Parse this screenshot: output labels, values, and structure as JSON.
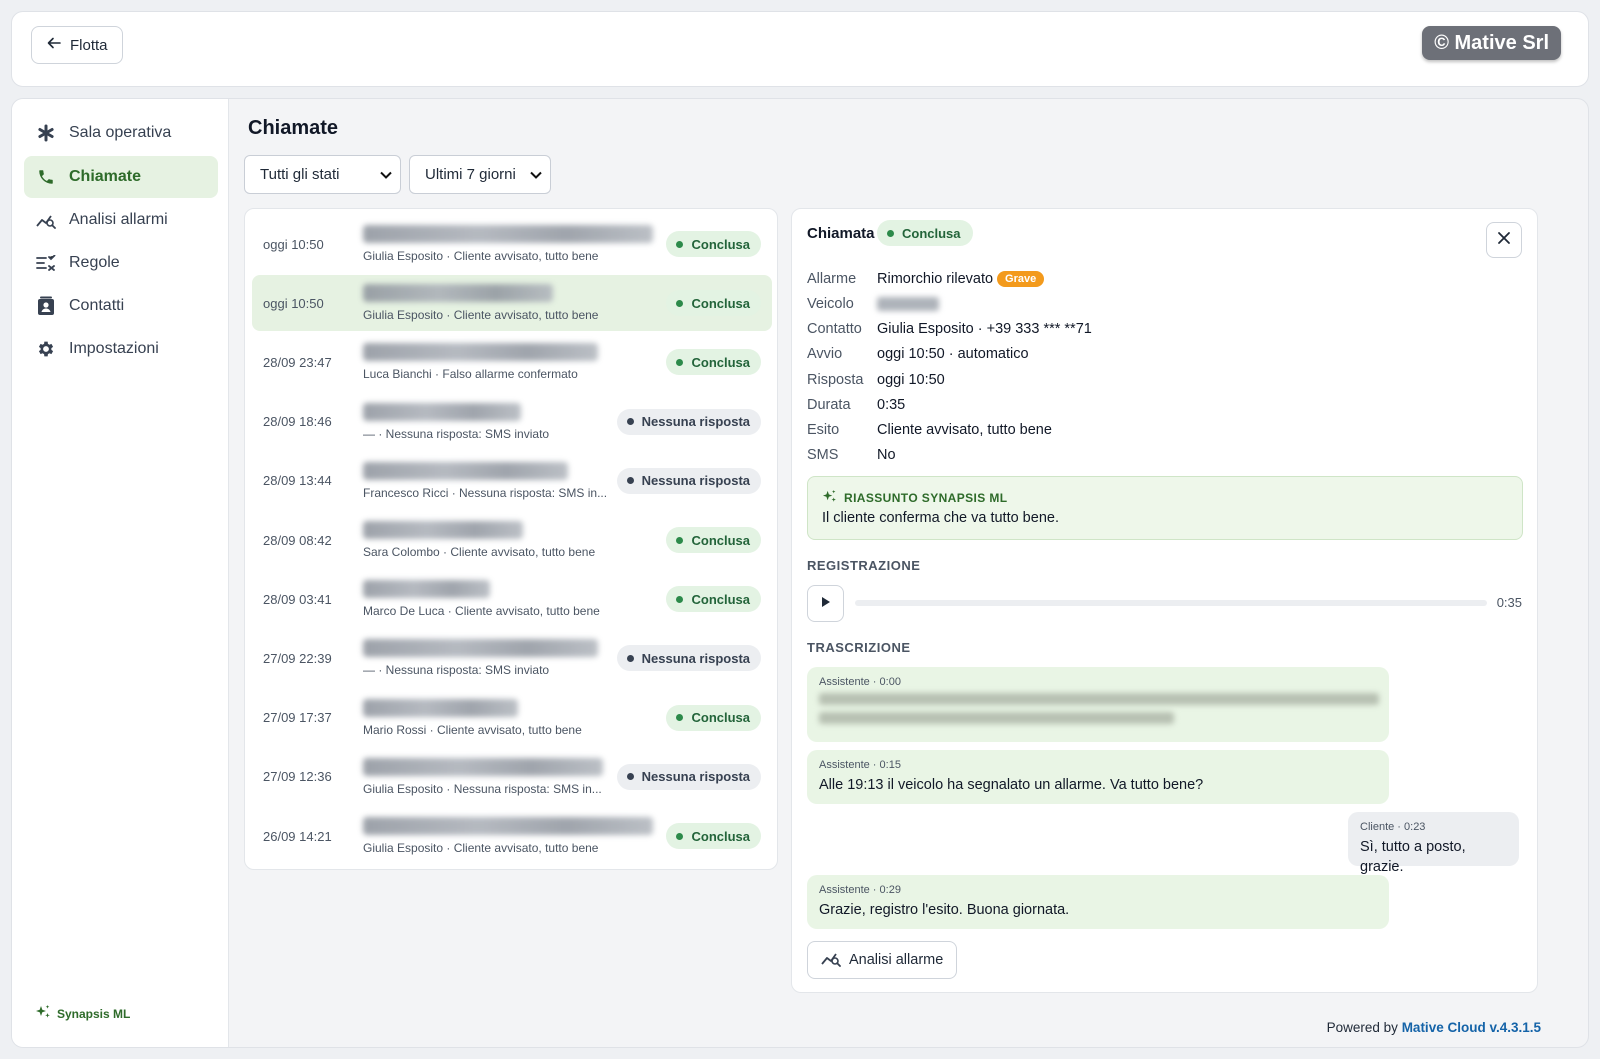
{
  "header": {
    "back_label": "Flotta",
    "brand": "© Mative Srl"
  },
  "sidebar": {
    "items": [
      {
        "label": "Sala operativa",
        "icon": "asterisk-icon",
        "active": false
      },
      {
        "label": "Chiamate",
        "icon": "phone-icon",
        "active": true
      },
      {
        "label": "Analisi allarmi",
        "icon": "chart-search-icon",
        "active": false
      },
      {
        "label": "Regole",
        "icon": "rules-icon",
        "active": false
      },
      {
        "label": "Contatti",
        "icon": "contact-card-icon",
        "active": false
      },
      {
        "label": "Impostazioni",
        "icon": "gear-icon",
        "active": false
      }
    ],
    "brand": "Synapsis ML"
  },
  "main": {
    "title": "Chiamate",
    "filter_status": "Tutti gli stati",
    "filter_period": "Ultimi 7 giorni"
  },
  "calls": [
    {
      "time": "oggi 10:50",
      "sub": "Giulia Esposito · Cliente avvisato, tutto bene",
      "status": "Conclusa",
      "kind": "ok"
    },
    {
      "time": "oggi 10:50",
      "sub": "Giulia Esposito · Cliente avvisato, tutto bene",
      "status": "Conclusa",
      "kind": "ok"
    },
    {
      "time": "28/09 23:47",
      "sub": "Luca Bianchi · Falso allarme confermato",
      "status": "Conclusa",
      "kind": "ok"
    },
    {
      "time": "28/09 18:46",
      "sub": "— · Nessuna risposta: SMS inviato",
      "status": "Nessuna risposta",
      "kind": "none"
    },
    {
      "time": "28/09 13:44",
      "sub": "Francesco Ricci · Nessuna risposta: SMS in...",
      "status": "Nessuna risposta",
      "kind": "none"
    },
    {
      "time": "28/09 08:42",
      "sub": "Sara Colombo · Cliente avvisato, tutto bene",
      "status": "Conclusa",
      "kind": "ok"
    },
    {
      "time": "28/09 03:41",
      "sub": "Marco De Luca · Cliente avvisato, tutto bene",
      "status": "Conclusa",
      "kind": "ok"
    },
    {
      "time": "27/09 22:39",
      "sub": "— · Nessuna risposta: SMS inviato",
      "status": "Nessuna risposta",
      "kind": "none"
    },
    {
      "time": "27/09 17:37",
      "sub": "Mario Rossi · Cliente avvisato, tutto bene",
      "status": "Conclusa",
      "kind": "ok"
    },
    {
      "time": "27/09 12:36",
      "sub": "Giulia Esposito · Nessuna risposta: SMS in...",
      "status": "Nessuna risposta",
      "kind": "none"
    },
    {
      "time": "26/09 14:21",
      "sub": "Giulia Esposito · Cliente avvisato, tutto bene",
      "status": "Conclusa",
      "kind": "ok"
    }
  ],
  "detail": {
    "title": "Chiamata",
    "status": "Conclusa",
    "fields": {
      "allarme_label": "Allarme",
      "allarme": "Rimorchio rilevato",
      "severity": "Grave",
      "veicolo_label": "Veicolo",
      "contatto_label": "Contatto",
      "contatto": "Giulia Esposito · +39 333 *** **71",
      "avvio_label": "Avvio",
      "avvio": "oggi 10:50 · automatico",
      "risposta_label": "Risposta",
      "risposta": "oggi 10:50",
      "durata_label": "Durata",
      "durata": "0:35",
      "esito_label": "Esito",
      "esito": "Cliente avvisato, tutto bene",
      "sms_label": "SMS",
      "sms": "No"
    },
    "summary_title": "RIASSUNTO SYNAPSIS ML",
    "summary_text": "Il cliente conferma che va tutto bene.",
    "recording_label": "REGISTRAZIONE",
    "recording_duration": "0:35",
    "recording_progress": 0,
    "transcript_label": "TRASCRIZIONE",
    "transcript": [
      {
        "meta": "Assistente · 0:00",
        "text": "",
        "speaker": "assistant"
      },
      {
        "meta": "Assistente · 0:15",
        "text": "Alle 19:13 il veicolo ha segnalato un allarme. Va tutto bene?",
        "speaker": "assistant"
      },
      {
        "meta": "Cliente · 0:23",
        "text": "Sì, tutto a posto, grazie.",
        "speaker": "client"
      },
      {
        "meta": "Assistente · 0:29",
        "text": "Grazie, registro l'esito. Buona giornata.",
        "speaker": "assistant"
      }
    ],
    "analysis_button": "Analisi allarme"
  },
  "footer": {
    "prefix": "Powered by",
    "link": "Mative Cloud v.4.3.1.5"
  },
  "colors": {
    "accent_green": "#2e6b2a",
    "badge_ok_bg": "#e3f3e3",
    "grave": "#f39a1c",
    "link_blue": "#1463a8"
  }
}
